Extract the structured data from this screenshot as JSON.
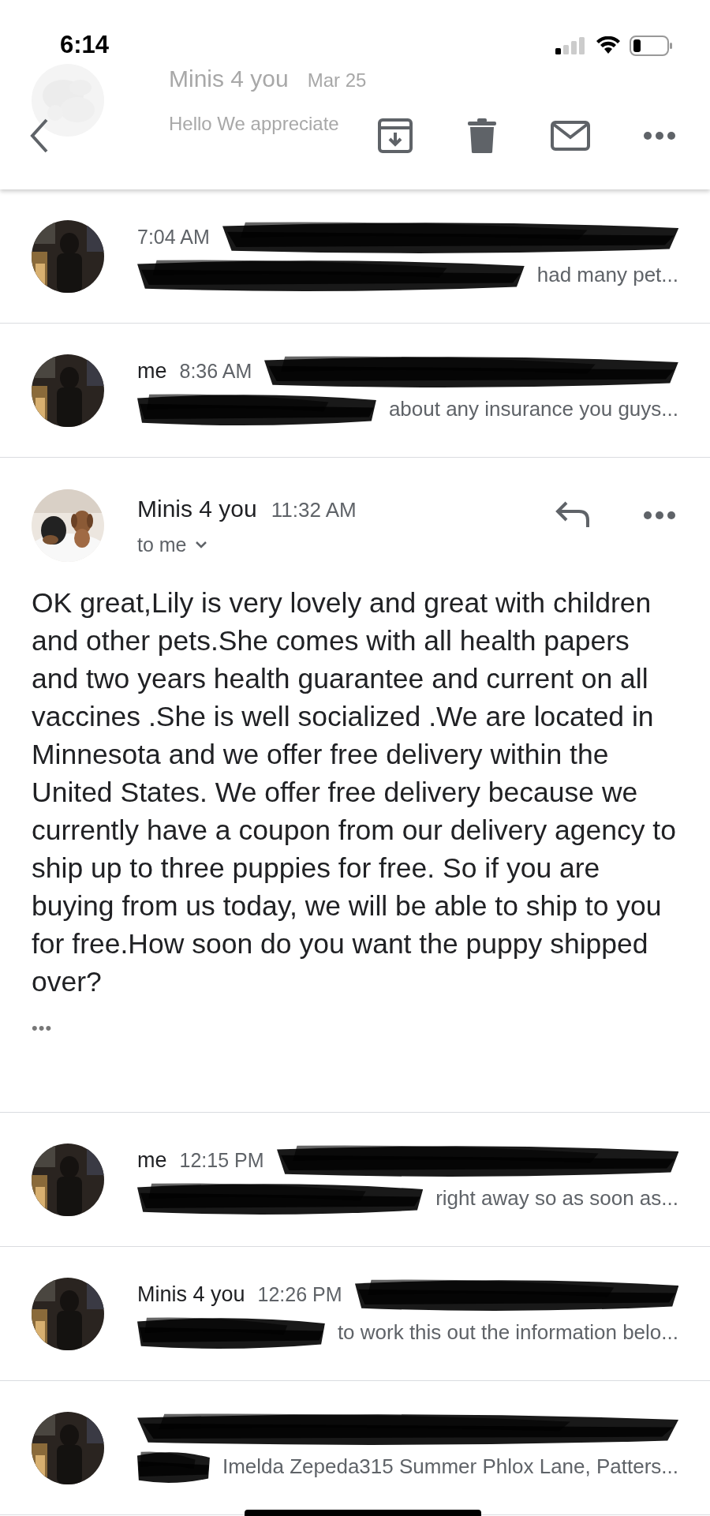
{
  "status_bar": {
    "time": "6:14"
  },
  "behind_header": {
    "sender": "Minis 4 you",
    "date": "Mar 25",
    "preview": "Hello We appreciate"
  },
  "thread_before": [
    {
      "time": "7:04 AM",
      "preview": "had many pet..."
    },
    {
      "sender": "me",
      "time": "8:36 AM",
      "preview": "about any insurance you guys..."
    }
  ],
  "message": {
    "sender": "Minis 4 you",
    "time": "11:32 AM",
    "recipient": "to me",
    "body": "OK great,Lily is very lovely and great with children and other pets.She comes with all health papers and two years health guarantee and current on all vaccines .She is well socialized .We are located in Minnesota and we offer free delivery within the United States. We offer free delivery because we currently have a coupon from our delivery agency to ship up to three puppies for free. So if you are buying from us today, we will be able to ship to you for free.How soon do you want the puppy shipped over?",
    "trimmed": "•••"
  },
  "thread_after": [
    {
      "sender": "me",
      "time": "12:15 PM",
      "preview": "right away so as soon as..."
    },
    {
      "sender": "Minis 4 you",
      "time": "12:26 PM",
      "preview": "to work this out the information belo..."
    },
    {
      "preview": "Imelda Zepeda315 Summer Phlox Lane, Patters..."
    }
  ]
}
